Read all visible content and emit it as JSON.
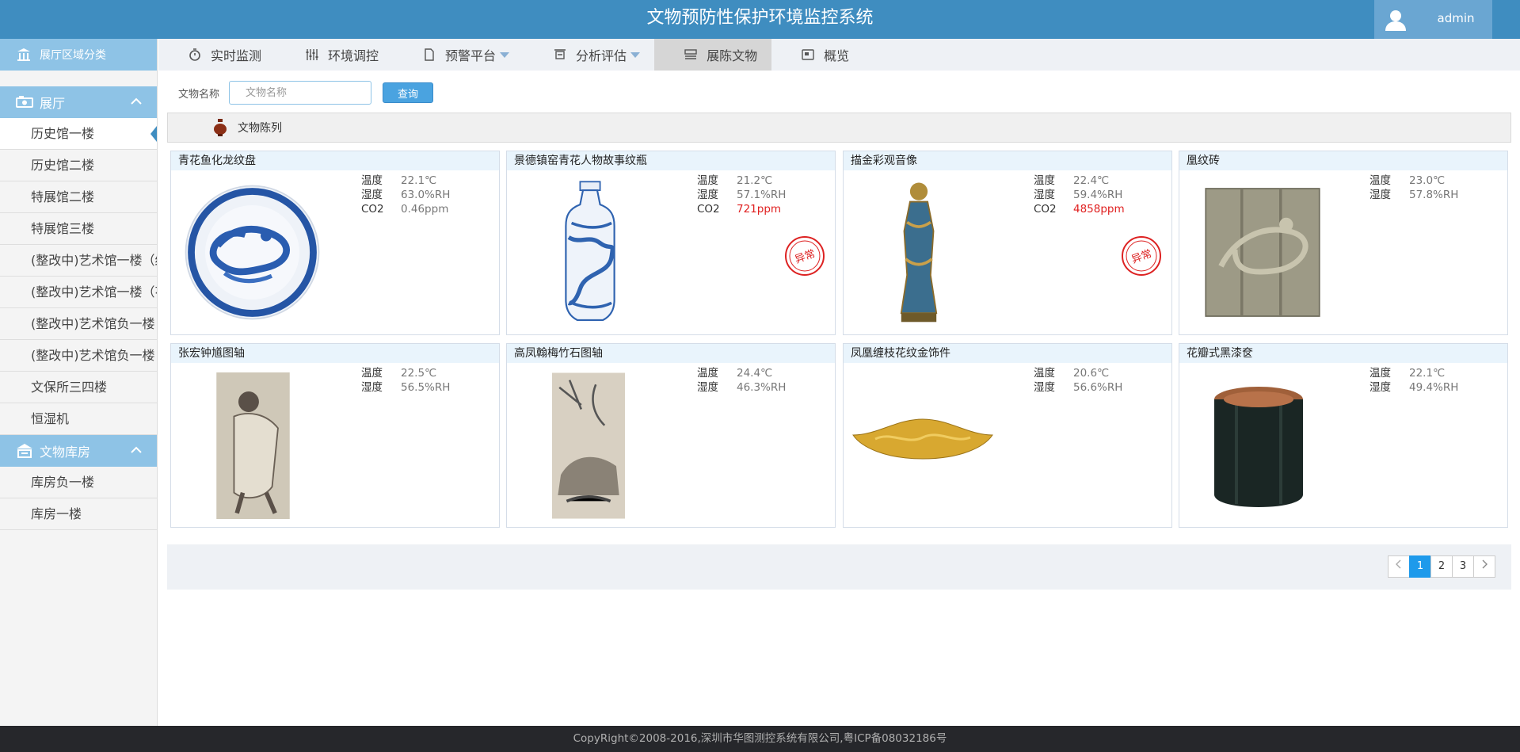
{
  "header": {
    "title": "文物预防性保护环境监控系统",
    "user": "admin"
  },
  "sidebar": {
    "header_label": "展厅区域分类",
    "groups": [
      {
        "label": "展厅",
        "items": [
          "历史馆一楼",
          "历史馆二楼",
          "特展馆二楼",
          "特展馆三楼",
          "(整改中)艺术馆一楼（织",
          "(整改中)艺术馆一楼（花",
          "(整改中)艺术馆负一楼",
          "(整改中)艺术馆负一楼",
          "文保所三四楼",
          "恒湿机"
        ]
      },
      {
        "label": "文物库房",
        "items": [
          "库房负一楼",
          "库房一楼"
        ]
      }
    ]
  },
  "nav": {
    "items": [
      "实时监测",
      "环境调控",
      "预警平台",
      "分析评估",
      "展陈文物",
      "概览"
    ]
  },
  "search": {
    "label": "文物名称",
    "placeholder": "文物名称",
    "button": "查询"
  },
  "section": {
    "title": "文物陈列"
  },
  "labels": {
    "temp": "温度",
    "humid": "湿度",
    "co2": "CO2",
    "stamp": "异常"
  },
  "cards": [
    {
      "title": "青花鱼化龙纹盘",
      "temp": "22.1℃",
      "humid": "63.0%RH",
      "co2": "0.46ppm",
      "abnormal": false
    },
    {
      "title": "景德镇窑青花人物故事纹瓶",
      "temp": "21.2℃",
      "humid": "57.1%RH",
      "co2": "721ppm",
      "abnormal": true
    },
    {
      "title": "描金彩观音像",
      "temp": "22.4℃",
      "humid": "59.4%RH",
      "co2": "4858ppm",
      "abnormal": true
    },
    {
      "title": "凰纹砖",
      "temp": "23.0℃",
      "humid": "57.8%RH"
    },
    {
      "title": "张宏钟馗图轴",
      "temp": "22.5℃",
      "humid": "56.5%RH"
    },
    {
      "title": "高凤翰梅竹石图轴",
      "temp": "24.4℃",
      "humid": "46.3%RH"
    },
    {
      "title": "凤凰缠枝花纹金饰件",
      "temp": "20.6℃",
      "humid": "56.6%RH"
    },
    {
      "title": "花瓣式黑漆奁",
      "temp": "22.1℃",
      "humid": "49.4%RH"
    }
  ],
  "pagination": {
    "pages": [
      "1",
      "2",
      "3"
    ],
    "current": "1"
  },
  "footer": {
    "text": "CopyRight©2008-2016,深圳市华图测控系统有限公司,粤ICP备08032186号"
  },
  "colors": {
    "header": "#3f8dc0",
    "sidebar_accent": "#8ec3e6",
    "alarm": "#e02020",
    "page_active": "#1e9aeb"
  }
}
